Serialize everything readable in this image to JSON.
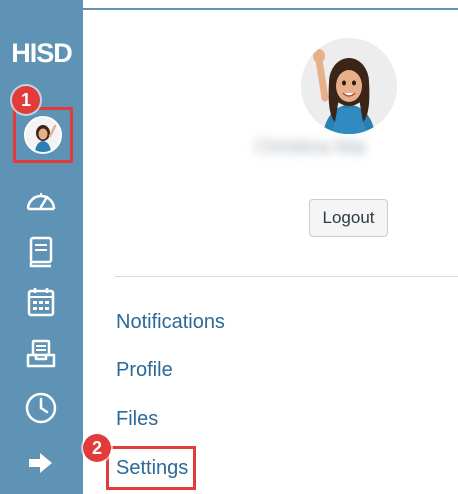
{
  "sidebar": {
    "logo_text": "HISD",
    "nav_icons": [
      "user-avatar-icon",
      "dashboard-icon",
      "courses-icon",
      "calendar-icon",
      "inbox-icon",
      "history-icon",
      "logout-arrow-icon"
    ]
  },
  "annotations": {
    "step1": "1",
    "step2": "2",
    "highlight_color": "#e23b3b"
  },
  "account_panel": {
    "user_name": "Christina Mai",
    "logout_label": "Logout",
    "links": [
      "Notifications",
      "Profile",
      "Files",
      "Settings"
    ]
  },
  "colors": {
    "sidebar": "#5e93b6",
    "link": "#2b6a98"
  }
}
